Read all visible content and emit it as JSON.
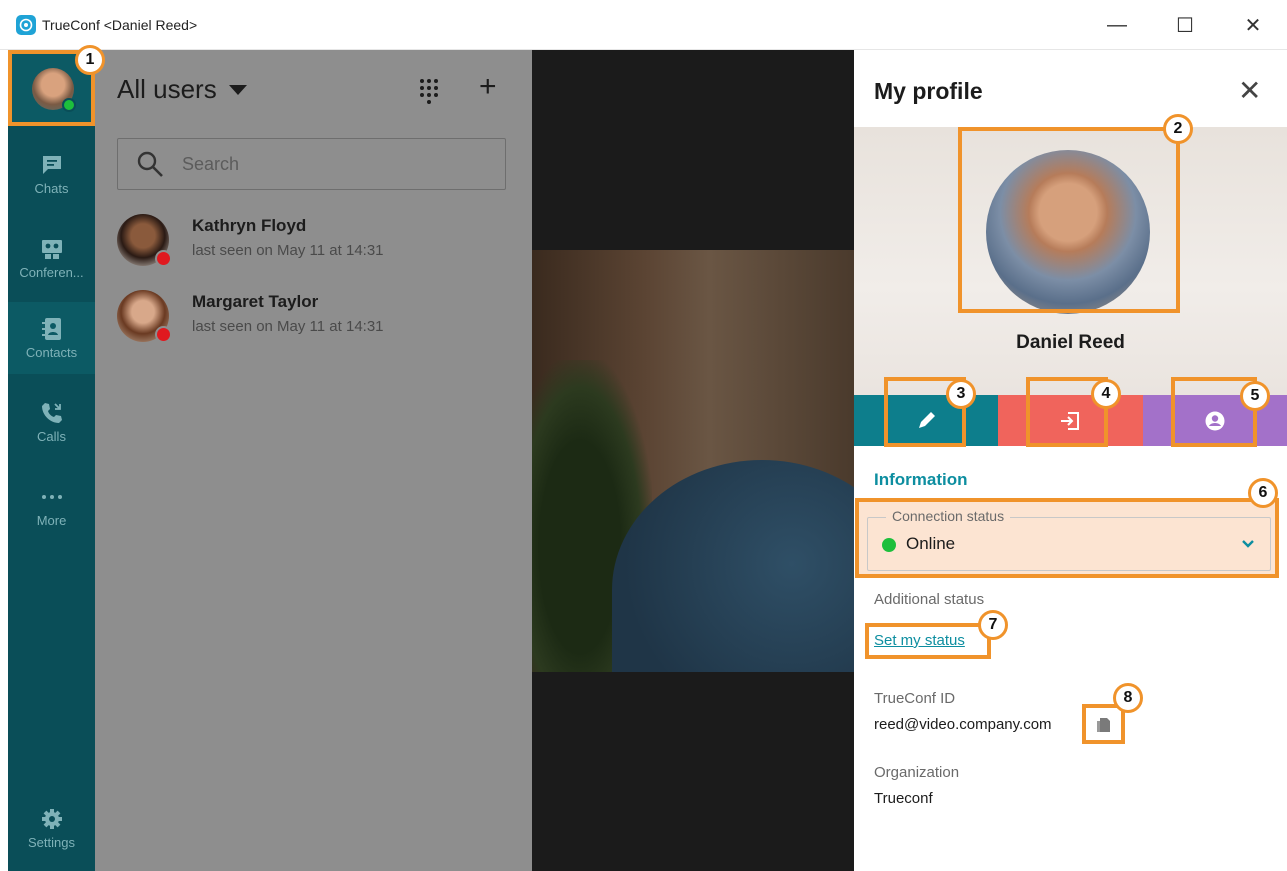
{
  "window": {
    "title": "TrueConf <Daniel Reed>",
    "minimize": "—",
    "maximize": "☐",
    "close": "✕"
  },
  "rail": {
    "items": [
      {
        "label": "Chats",
        "icon": "chat-icon"
      },
      {
        "label": "Conferen...",
        "icon": "conference-icon"
      },
      {
        "label": "Contacts",
        "icon": "contacts-icon"
      },
      {
        "label": "Calls",
        "icon": "calls-icon"
      },
      {
        "label": "More",
        "icon": "more-icon"
      },
      {
        "label": "Settings",
        "icon": "gear-icon"
      }
    ],
    "active": "Contacts",
    "user_status_color": "#1dbf3c"
  },
  "contacts": {
    "filter_label": "All users",
    "search_placeholder": "Search",
    "add_label": "+",
    "items": [
      {
        "name": "Kathryn Floyd",
        "last_seen": "last seen on May 11 at 14:31",
        "status": "offline"
      },
      {
        "name": "Margaret Taylor",
        "last_seen": "last seen on May 11 at 14:31",
        "status": "offline"
      }
    ]
  },
  "profile": {
    "title": "My profile",
    "close_label": "✕",
    "name": "Daniel Reed",
    "actions": [
      {
        "name": "edit",
        "icon": "pencil-icon",
        "color": "#0d7e8c"
      },
      {
        "name": "logout",
        "icon": "logout-icon",
        "color": "#f0645c"
      },
      {
        "name": "account",
        "icon": "user-icon",
        "color": "#a371c9"
      }
    ],
    "section_title": "Information",
    "connection_status_label": "Connection status",
    "connection_status_value": "Online",
    "additional_status_label": "Additional status",
    "set_status_link": "Set my status",
    "trueconf_id_label": "TrueConf ID",
    "trueconf_id_value": "reed@video.company.com",
    "organization_label": "Organization",
    "organization_value": "Trueconf"
  },
  "callouts": [
    "1",
    "2",
    "3",
    "4",
    "5",
    "6",
    "7",
    "8"
  ],
  "colors": {
    "accent": "#0d8ea0",
    "highlight": "#f0932b",
    "rail_bg": "#0a4e58",
    "online": "#1dbf3c",
    "offline": "#e0191f"
  }
}
